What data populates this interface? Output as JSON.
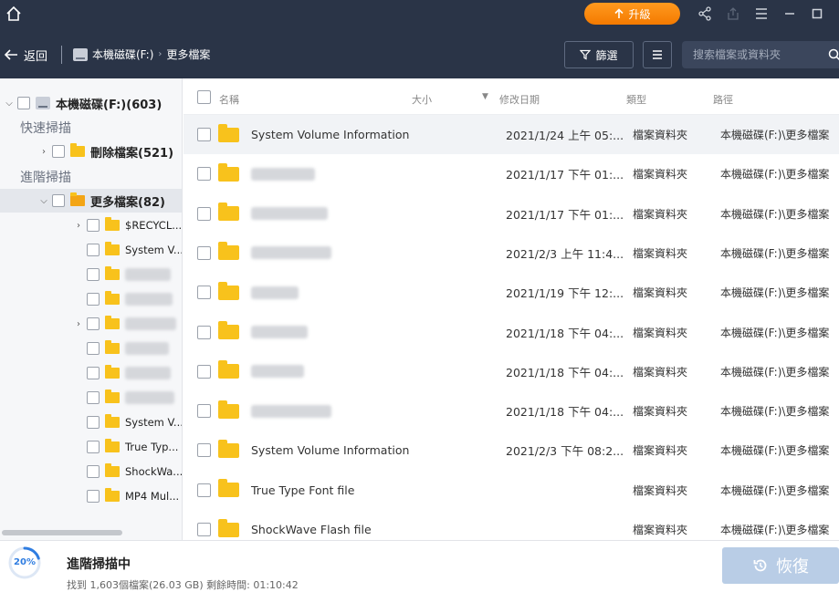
{
  "titlebar": {
    "upgrade_label": "升級"
  },
  "nav": {
    "back_label": "返回",
    "crumb_drive": "本機磁碟(F:)",
    "crumb_folder": "更多檔案",
    "filter_label": "篩選",
    "search_placeholder": "搜索檔案或資料夾"
  },
  "sidebar": {
    "root_label": "本機磁碟(F:)(603)",
    "quick_scan_label": "快速掃描",
    "deleted_label": "刪除檔案(521)",
    "advanced_scan_label": "進階掃描",
    "more_files_label": "更多檔案(82)",
    "sub_items": [
      {
        "label": "$RECYCL...",
        "expandable": true,
        "blurred": false
      },
      {
        "label": "System V...",
        "expandable": false,
        "blurred": false
      },
      {
        "label": "",
        "expandable": false,
        "blurred": true
      },
      {
        "label": "",
        "expandable": false,
        "blurred": true
      },
      {
        "label": "",
        "expandable": true,
        "blurred": true
      },
      {
        "label": "",
        "expandable": false,
        "blurred": true
      },
      {
        "label": "",
        "expandable": false,
        "blurred": true
      },
      {
        "label": "",
        "expandable": false,
        "blurred": true
      },
      {
        "label": "System V...",
        "expandable": false,
        "blurred": false
      },
      {
        "label": "True Typ...",
        "expandable": false,
        "blurred": false
      },
      {
        "label": "ShockWa...",
        "expandable": false,
        "blurred": false
      },
      {
        "label": "MP4 Mul...",
        "expandable": false,
        "blurred": false
      }
    ]
  },
  "list": {
    "columns": {
      "name": "名稱",
      "size": "大小",
      "modified": "修改日期",
      "type": "類型",
      "path": "路徑"
    },
    "rows": [
      {
        "name": "System Volume Information",
        "date": "2021/1/24 上午 05:...",
        "type": "檔案資料夾",
        "path": "本機磁碟(F:)\\更多檔案",
        "blurred": false,
        "highlight": true
      },
      {
        "name": "",
        "date": "2021/1/17 下午 01:...",
        "type": "檔案資料夾",
        "path": "本機磁碟(F:)\\更多檔案",
        "blurred": true,
        "highlight": false
      },
      {
        "name": "",
        "date": "2021/1/17 下午 01:...",
        "type": "檔案資料夾",
        "path": "本機磁碟(F:)\\更多檔案",
        "blurred": true,
        "highlight": false
      },
      {
        "name": "",
        "date": "2021/2/3 上午 11:4...",
        "type": "檔案資料夾",
        "path": "本機磁碟(F:)\\更多檔案",
        "blurred": true,
        "highlight": false
      },
      {
        "name": "",
        "date": "2021/1/19 下午 12:...",
        "type": "檔案資料夾",
        "path": "本機磁碟(F:)\\更多檔案",
        "blurred": true,
        "highlight": false
      },
      {
        "name": "",
        "date": "2021/1/18 下午 04:...",
        "type": "檔案資料夾",
        "path": "本機磁碟(F:)\\更多檔案",
        "blurred": true,
        "highlight": false
      },
      {
        "name": "",
        "date": "2021/1/18 下午 04:...",
        "type": "檔案資料夾",
        "path": "本機磁碟(F:)\\更多檔案",
        "blurred": true,
        "highlight": false
      },
      {
        "name": "",
        "date": "2021/1/18 下午 04:...",
        "type": "檔案資料夾",
        "path": "本機磁碟(F:)\\更多檔案",
        "blurred": true,
        "highlight": false
      },
      {
        "name": "System Volume Information",
        "date": "2021/2/3 下午 08:2...",
        "type": "檔案資料夾",
        "path": "本機磁碟(F:)\\更多檔案",
        "blurred": false,
        "highlight": false
      },
      {
        "name": "True Type Font file",
        "date": "",
        "type": "檔案資料夾",
        "path": "本機磁碟(F:)\\更多檔案",
        "blurred": false,
        "highlight": false
      },
      {
        "name": "ShockWave Flash file",
        "date": "",
        "type": "檔案資料夾",
        "path": "本機磁碟(F:)\\更多檔案",
        "blurred": false,
        "highlight": false
      }
    ]
  },
  "status": {
    "progress_percent": 20,
    "progress_label": "20%",
    "title": "進階掃描中",
    "subtitle": "找到 1,603個檔案(26.03 GB)  剩餘時間: 01:10:42",
    "recover_label": "恢復"
  },
  "colors": {
    "header_bg": "#2a3447",
    "accent_orange": "#f47a00",
    "folder_yellow": "#f8c21c",
    "progress_blue": "#2f7de1",
    "recover_disabled": "#b9cde6"
  }
}
